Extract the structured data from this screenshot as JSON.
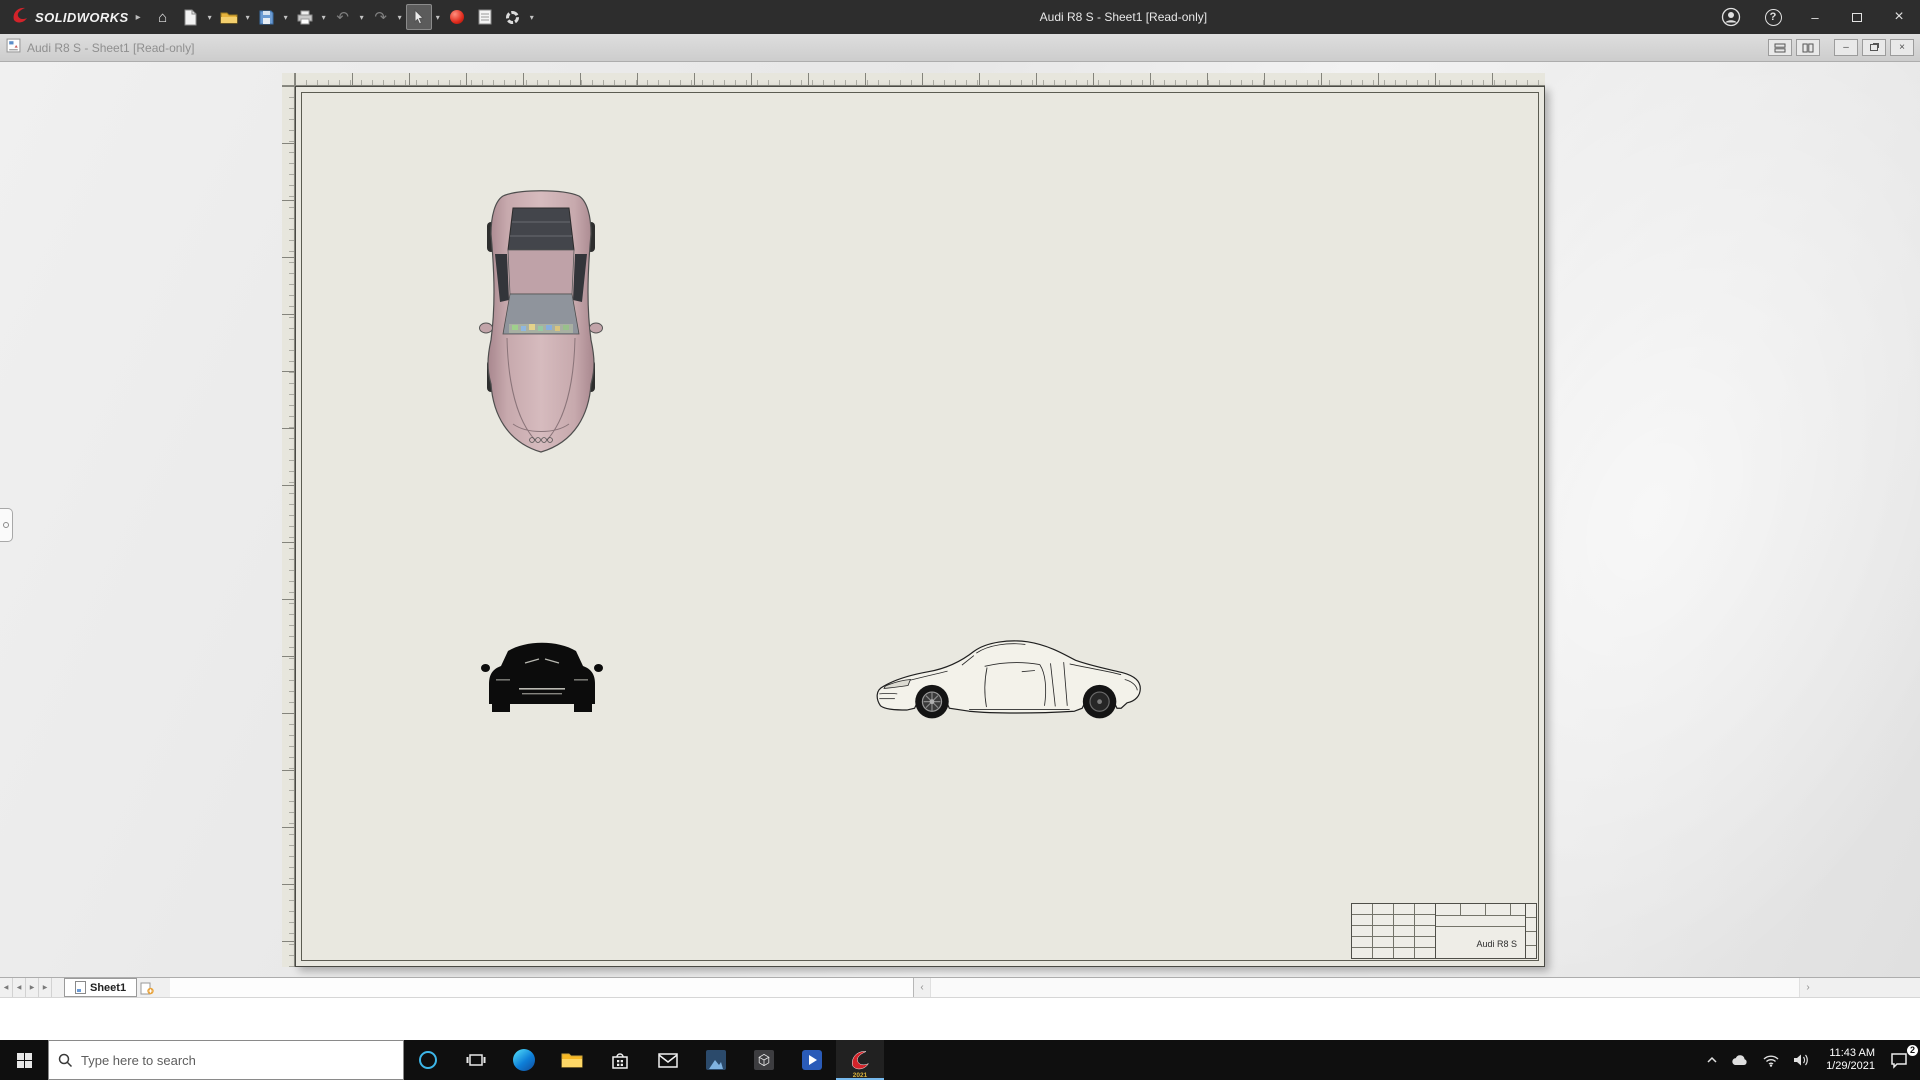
{
  "titlebar": {
    "brand": "SOLIDWORKS",
    "title": "Audi R8 S - Sheet1 [Read-only]",
    "glyphs": {
      "brand_chevron": "▸",
      "home": "⌂",
      "dropdown": "▾",
      "undo": "↶",
      "redo": "↷",
      "help": "?",
      "minimize": "–",
      "close": "×"
    }
  },
  "docbar": {
    "title": "Audi R8 S - Sheet1 [Read-only]",
    "glyphs": {
      "minimize": "–",
      "close": "×"
    }
  },
  "sheet": {
    "tab_label": "Sheet1",
    "title_block_name": "Audi R8 S"
  },
  "tabbar_glyphs": {
    "first": "◀",
    "prev": "◀",
    "next": "▶",
    "last": "▶",
    "scroll_left": "‹",
    "scroll_right": "›"
  },
  "taskbar": {
    "search_placeholder": "Type here to search",
    "time": "11:43 AM",
    "date": "1/29/2021",
    "solidworks_year": "2021",
    "action_badge": "2"
  },
  "icons": {
    "toolbar": [
      "home-icon",
      "new-document-icon",
      "open-folder-icon",
      "save-icon",
      "print-icon",
      "undo-icon",
      "redo-icon",
      "select-cursor-icon",
      "3dexperience-icon",
      "sheet-format-icon",
      "options-gear-icon"
    ],
    "titlebar_right": [
      "account-icon",
      "help-icon",
      "minimize-icon",
      "maximize-icon",
      "close-icon"
    ],
    "taskbar": [
      "start-icon",
      "search-icon",
      "cortana-icon",
      "task-view-icon",
      "edge-icon",
      "file-explorer-icon",
      "store-icon",
      "mail-icon",
      "photos-icon",
      "cube-icon",
      "media-icon",
      "solidworks-icon",
      "tray-chevron-icon",
      "cloud-icon",
      "network-icon",
      "volume-icon",
      "action-center-icon"
    ]
  }
}
